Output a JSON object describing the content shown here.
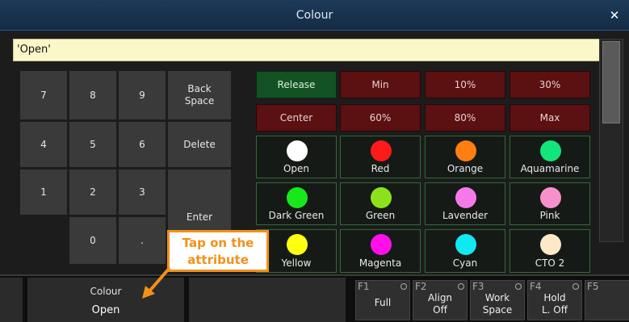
{
  "window": {
    "title": "Colour",
    "close_glyph": "✕"
  },
  "command_line": {
    "value": "'Open'"
  },
  "keypad": {
    "k7": "7",
    "k8": "8",
    "k9": "9",
    "back_space": "Back Space",
    "k4": "4",
    "k5": "5",
    "k6": "6",
    "delete": "Delete",
    "k1": "1",
    "k2": "2",
    "k3": "3",
    "enter": "Enter",
    "k0": "0",
    "dot": "."
  },
  "presets": {
    "release": "Release",
    "min": "Min",
    "p10": "10%",
    "p30": "30%",
    "center": "Center",
    "p60": "60%",
    "p80": "80%",
    "max": "Max"
  },
  "colors": [
    {
      "label": "Open",
      "hex": "#ffffff"
    },
    {
      "label": "Red",
      "hex": "#ff1a1a"
    },
    {
      "label": "Orange",
      "hex": "#ff7f10"
    },
    {
      "label": "Aquamarine",
      "hex": "#12e57a"
    },
    {
      "label": "Dark Green",
      "hex": "#16e81a"
    },
    {
      "label": "Green",
      "hex": "#8ce21a"
    },
    {
      "label": "Lavender",
      "hex": "#f57ae9"
    },
    {
      "label": "Pink",
      "hex": "#f691cc"
    },
    {
      "label": "Yellow",
      "hex": "#ffff10"
    },
    {
      "label": "Magenta",
      "hex": "#ff10ea"
    },
    {
      "label": "Cyan",
      "hex": "#10e9f2"
    },
    {
      "label": "CTO 2",
      "hex": "#fde9c8"
    }
  ],
  "bottom_bar": {
    "attribute_name": "Colour",
    "attribute_value": "Open",
    "fkeys": [
      {
        "num": "F1",
        "label": "Full"
      },
      {
        "num": "F2",
        "label": "Align Off"
      },
      {
        "num": "F3",
        "label": "Work Space"
      },
      {
        "num": "F4",
        "label": "Hold L. Off"
      },
      {
        "num": "F5",
        "label": ""
      }
    ]
  },
  "callout": {
    "text": "Tap on the attribute",
    "arrow_color": "#f29118"
  }
}
